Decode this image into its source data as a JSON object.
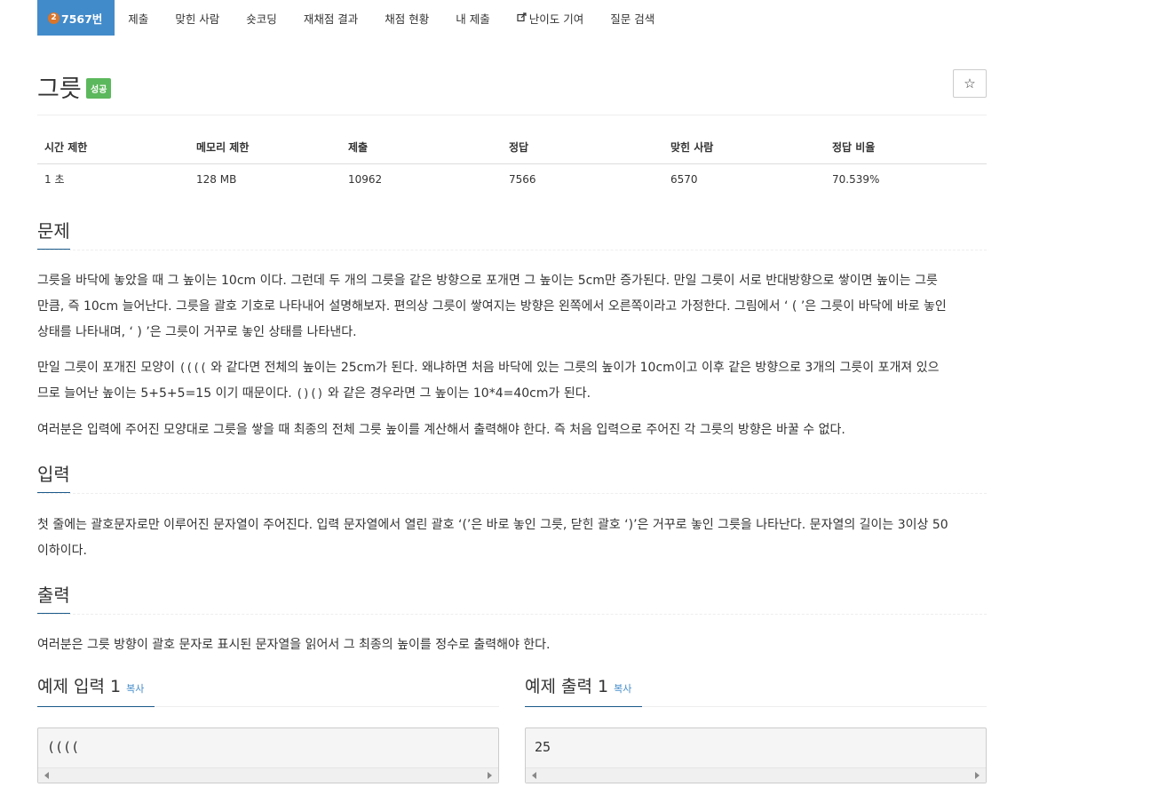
{
  "nav": {
    "problem_number": "7567번",
    "items": [
      "제출",
      "맞힌 사람",
      "숏코딩",
      "재채점 결과",
      "채점 현황",
      "내 제출",
      "난이도 기여",
      "질문 검색"
    ]
  },
  "problem": {
    "title": "그릇",
    "status_label": "성공",
    "star": "☆"
  },
  "info_table": {
    "headers": [
      "시간 제한",
      "메모리 제한",
      "제출",
      "정답",
      "맞힌 사람",
      "정답 비율"
    ],
    "values": [
      "1 초",
      "128 MB",
      "10962",
      "7566",
      "6570",
      "70.539%"
    ]
  },
  "sections": {
    "problem_heading": "문제",
    "problem_p1_line1": "그릇을 바닥에 놓았을 때 그 높이는 10cm 이다. 그런데 두 개의 그릇을 같은 방향으로 포개면 그 높이는 5cm만 증가된다. 만일 그릇이 서로 반대방향으로 쌓이면 높이는 그릇",
    "problem_p1_line2": "만큼, 즉 10cm 늘어난다. 그릇을 괄호 기호로 나타내어 설명해보자. 편의상 그릇이 쌓여지는 방향은 왼쪽에서 오른쪽이라고 가정한다. 그림에서 ‘ ( ’은 그릇이 바닥에 바로 놓인",
    "problem_p1_line3": "상태를 나타내며, ‘ ) ’은 그릇이 거꾸로 놓인 상태를 나타낸다.",
    "problem_p2_a": "만일 그릇이 포개진 모양이 ",
    "problem_p2_code1": "((((",
    "problem_p2_b": " 와 같다면 전체의 높이는 25cm가 된다. 왜냐하면 처음 바닥에 있는 그릇의 높이가 10cm이고 이후 같은 방향으로 3개의 그릇이 포개져 있으",
    "problem_p2_c": "므로 늘어난 높이는 5+5+5=15 이기 때문이다. ",
    "problem_p2_code2": "()()",
    "problem_p2_d": " 와 같은 경우라면 그 높이는 10*4=40cm가 된다.",
    "problem_p3": "여러분은 입력에 주어진 모양대로 그릇을 쌓을 때 최종의 전체 그릇 높이를 계산해서 출력해야 한다. 즉 처음 입력으로 주어진 각 그릇의 방향은 바꿀 수 없다.",
    "input_heading": "입력",
    "input_line1": "첫 줄에는 괄호문자로만 이루어진 문자열이 주어진다. 입력 문자열에서 열린 괄호 ‘(’은 바로 놓인 그릇, 닫힌 괄호 ‘)’은 거꾸로 놓인 그릇을 나타난다. 문자열의 길이는 3이상 50",
    "input_line2": "이하이다.",
    "output_heading": "출력",
    "output_text": "여러분은 그릇 방향이 괄호 문자로 표시된 문자열을 읽어서 그 최종의 높이를 정수로 출력해야 한다."
  },
  "examples": {
    "input_title": "예제 입력 1",
    "output_title": "예제 출력 1",
    "copy_label": "복사",
    "input_value": "((((",
    "output_value": "25"
  }
}
